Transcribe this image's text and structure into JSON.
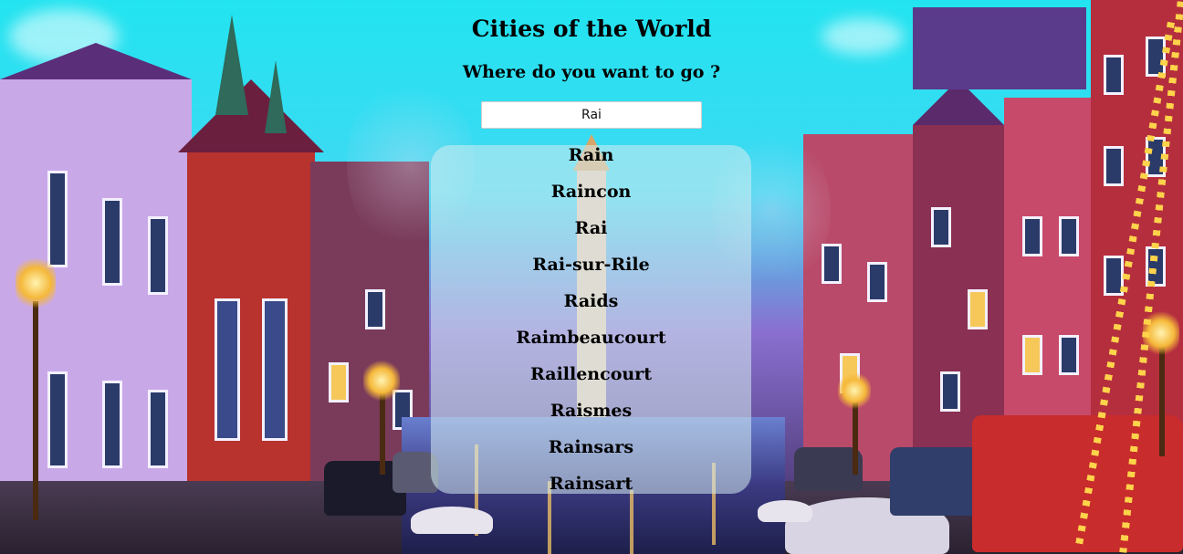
{
  "header": {
    "title": "Cities of the World",
    "subtitle": "Where do you want to go ?"
  },
  "search": {
    "value": "Rai",
    "placeholder": ""
  },
  "results": [
    "Rain",
    "Raincon",
    "Rai",
    "Rai-sur-Rile",
    "Raids",
    "Raimbeaucourt",
    "Raillencourt",
    "Raismes",
    "Rainsars",
    "Rainsart"
  ],
  "background": {
    "description_icon": "city-canal-photo",
    "sky_color": "#22e4f0"
  }
}
